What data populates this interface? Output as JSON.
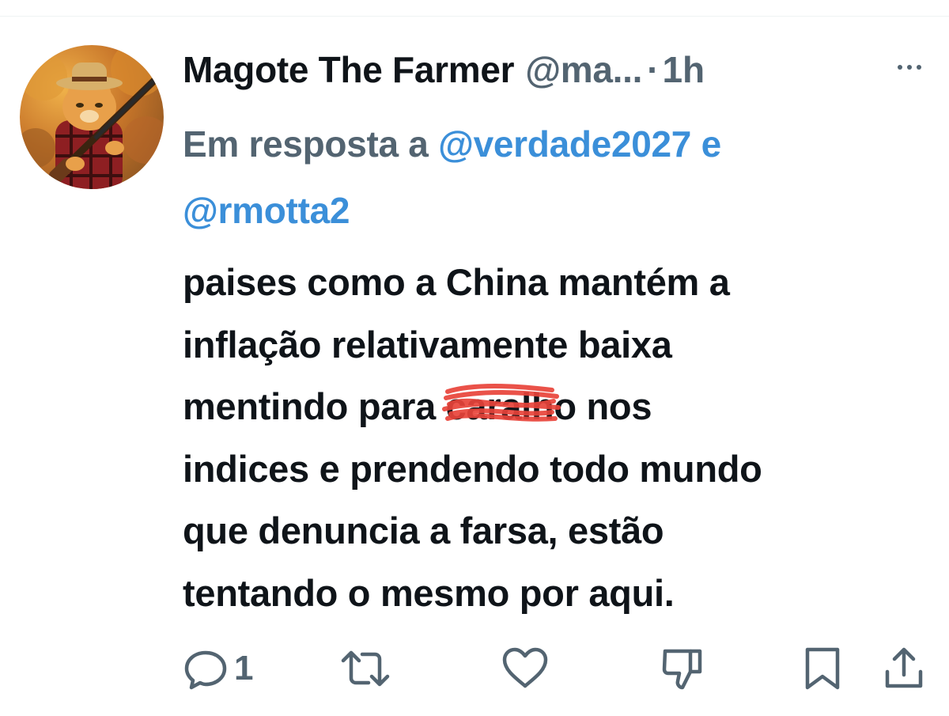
{
  "tweet": {
    "author": {
      "display_name": "Magote The Farmer",
      "handle": "@ma...",
      "avatar_icon": "cat-farmer-avatar"
    },
    "separator": "·",
    "time": "1h",
    "reply_context": {
      "prefix": "Em resposta a",
      "mention_1": "@verdade2027",
      "conjunction": "e",
      "mention_2": "@rmotta2"
    },
    "text": {
      "line_1": "paises como a China mantém a",
      "line_2": "inflação relativamente baixa",
      "line_3_before": "mentindo para ",
      "line_3_censored": "caralho",
      "line_3_after": " nos",
      "line_4": "indices e prendendo todo mundo",
      "line_5": "que denuncia a farsa, estão",
      "line_6": "tentando o mesmo por aqui."
    },
    "censor_color": "#e8433a",
    "actions": {
      "reply_count": "1",
      "icons": [
        "reply-icon",
        "retweet-icon",
        "like-icon",
        "dislike-icon",
        "bookmark-icon",
        "share-icon"
      ]
    },
    "colors": {
      "text": "#0f1419",
      "secondary": "#536471",
      "link": "#3b8fd9"
    }
  }
}
